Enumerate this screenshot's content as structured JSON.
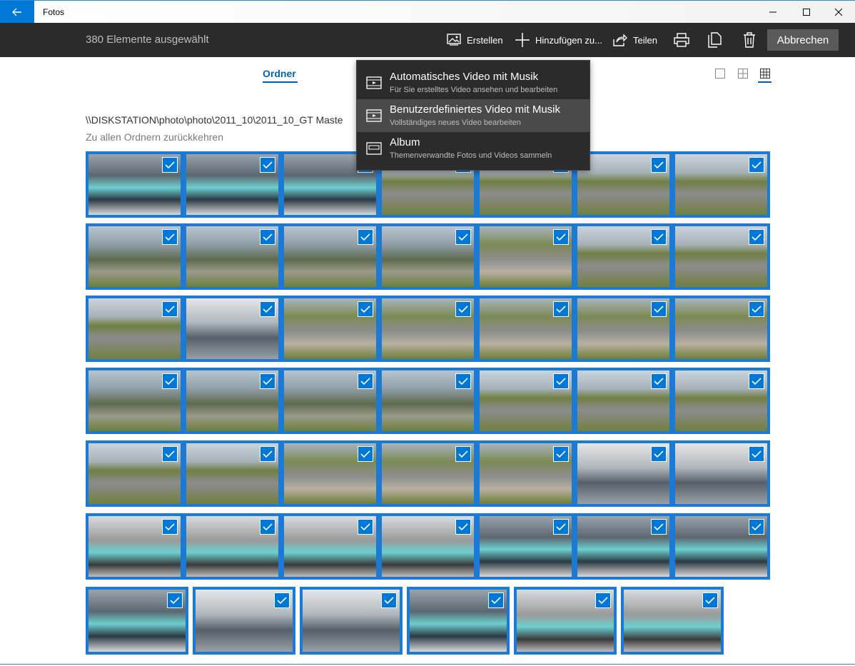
{
  "window": {
    "title": "Fotos"
  },
  "toolbar": {
    "selection_count": "380 Elemente ausgewählt",
    "create_label": "Erstellen",
    "add_label": "Hinzufügen zu...",
    "share_label": "Teilen",
    "cancel_label": "Abbrechen"
  },
  "tabs": {
    "folder_label": "Ordner"
  },
  "breadcrumb": {
    "path": "\\\\DISKSTATION\\photo\\photo\\2011_10\\2011_10_GT Maste",
    "back_link": "Zu allen Ordnern zurückkehren"
  },
  "create_menu": {
    "items": [
      {
        "title": "Automatisches Video mit Musik",
        "subtitle": "Für Sie erstelltes Video ansehen und bearbeiten",
        "icon": "video-auto-icon"
      },
      {
        "title": "Benutzerdefiniertes Video mit Musik",
        "subtitle": "Vollständiges neues Video bearbeiten",
        "icon": "video-custom-icon"
      },
      {
        "title": "Album",
        "subtitle": "Themenverwandte Fotos und Videos sammeln",
        "icon": "album-icon"
      }
    ]
  },
  "colors": {
    "accent": "#0078d7",
    "commandbar": "#2b2b2b",
    "selection_border": "#1a7ad6"
  },
  "photos": {
    "selected_all": true
  }
}
